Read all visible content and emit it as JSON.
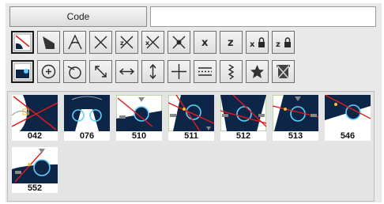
{
  "code": {
    "button_label": "Code",
    "input_value": ""
  },
  "toolbar": {
    "row1": [
      {
        "icon": "fillet-profile-icon",
        "selected": true
      },
      {
        "icon": "corner-profile-icon"
      },
      {
        "icon": "angle-dimension-icon"
      },
      {
        "icon": "cross-lines-icon"
      },
      {
        "icon": "cross-z-icon"
      },
      {
        "icon": "cross-x-icon"
      },
      {
        "icon": "cross-gear-icon"
      },
      {
        "icon": "x-icon",
        "text": "x"
      },
      {
        "icon": "z-icon",
        "text": "z"
      },
      {
        "icon": "x-lock-icon",
        "text": "x"
      },
      {
        "icon": "z-lock-icon",
        "text": "z"
      }
    ],
    "row2": [
      {
        "icon": "circle-profile-icon",
        "selected": true
      },
      {
        "icon": "circle-center-icon"
      },
      {
        "icon": "tangent-circle-icon"
      },
      {
        "icon": "diagonal-arrow-icon"
      },
      {
        "icon": "horizontal-arrow-icon"
      },
      {
        "icon": "vertical-arrow-icon"
      },
      {
        "icon": "crosshair-icon"
      },
      {
        "icon": "dashed-lines-icon"
      },
      {
        "icon": "zigzag-icon"
      },
      {
        "icon": "star-icon"
      },
      {
        "icon": "delete-icon"
      }
    ]
  },
  "library": {
    "items": [
      {
        "code": "042",
        "type": "a"
      },
      {
        "code": "076",
        "type": "b"
      },
      {
        "code": "510",
        "type": "c"
      },
      {
        "code": "511",
        "type": "d"
      },
      {
        "code": "512",
        "type": "e"
      },
      {
        "code": "513",
        "type": "f"
      },
      {
        "code": "546",
        "type": "g"
      },
      {
        "code": "552",
        "type": "h"
      }
    ]
  },
  "colors": {
    "navy": "#0d2547",
    "circle": "#5fd0ff",
    "line": "#e11c1c",
    "arrow": "#888888",
    "dot": "#f2c12e",
    "frame": "#7ab648"
  }
}
